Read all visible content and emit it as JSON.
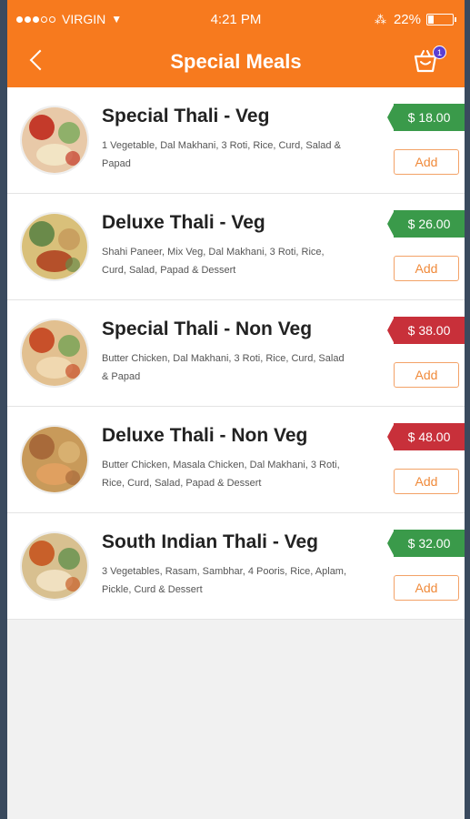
{
  "status_bar": {
    "carrier": "VIRGIN",
    "time": "4:21 PM",
    "battery": "22%",
    "battery_level": 0.22
  },
  "header": {
    "title": "Special Meals",
    "cart_count": "1",
    "background_color": "#f77a1e"
  },
  "meals": [
    {
      "name": "Special Thali - Veg",
      "description": "1 Vegetable, Dal Makhani, 3 Roti, Rice, Curd, Salad & Papad",
      "price": "$ 18.00",
      "type": "veg",
      "add_label": "Add"
    },
    {
      "name": "Deluxe Thali - Veg",
      "description": "Shahi Paneer, Mix Veg, Dal Makhani, 3 Roti, Rice, Curd, Salad, Papad & Dessert",
      "price": "$ 26.00",
      "type": "veg",
      "add_label": "Add"
    },
    {
      "name": "Special Thali - Non Veg",
      "description": "Butter Chicken, Dal Makhani, 3 Roti, Rice, Curd, Salad & Papad",
      "price": "$ 38.00",
      "type": "nonveg",
      "add_label": "Add"
    },
    {
      "name": "Deluxe Thali - Non Veg",
      "description": "Butter Chicken, Masala Chicken, Dal Makhani, 3 Roti, Rice, Curd, Salad, Papad & Dessert",
      "price": "$ 48.00",
      "type": "nonveg",
      "add_label": "Add"
    },
    {
      "name": "South Indian Thali - Veg",
      "description": "3 Vegetables, Rasam, Sambhar, 4 Pooris, Rice, Aplam, Pickle, Curd & Dessert",
      "price": "$ 32.00",
      "type": "veg",
      "add_label": "Add"
    }
  ],
  "colors": {
    "veg_price": "#3a9a4a",
    "nonveg_price": "#c8303a",
    "accent": "#f77a1e"
  }
}
